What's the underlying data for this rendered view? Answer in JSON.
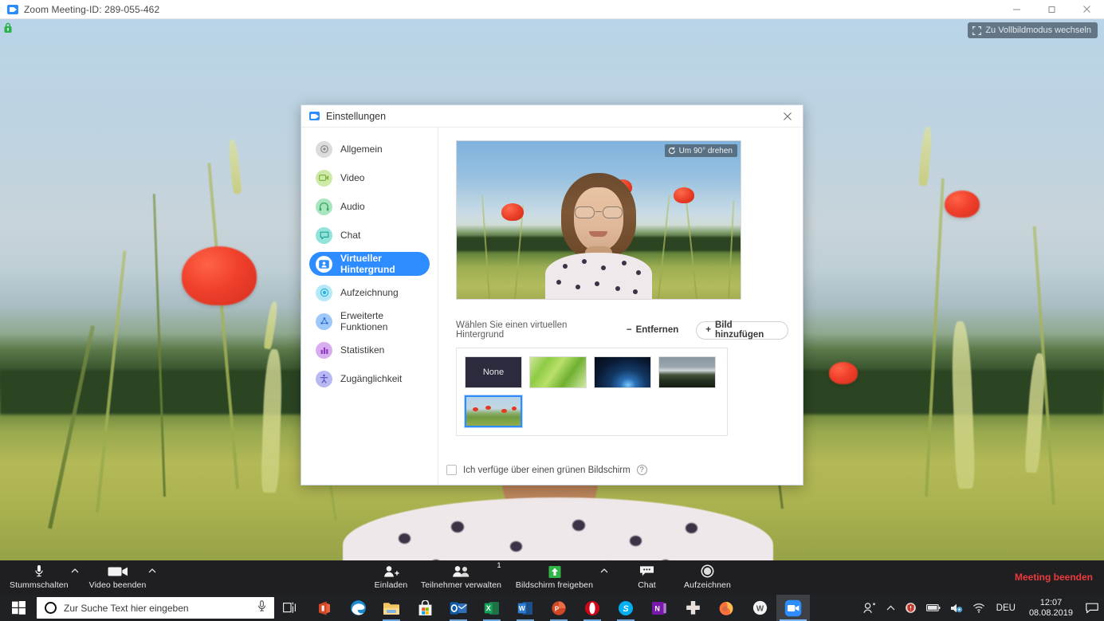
{
  "window": {
    "title": "Zoom Meeting-ID: 289-055-462",
    "minimize_label": "Minimieren",
    "maximize_label": "Maximieren",
    "close_label": "Schließen"
  },
  "stage": {
    "fullscreen_label": "Zu Vollbildmodus wechseln",
    "security_label": "Verschlüsselt"
  },
  "zoombar": {
    "mute_label": "Stummschalten",
    "mute_caret_label": "Audio-Optionen",
    "video_label": "Video beenden",
    "video_caret_label": "Video-Optionen",
    "invite_label": "Einladen",
    "participants_label": "Teilnehmer verwalten",
    "participants_count": "1",
    "share_label": "Bildschirm freigeben",
    "share_caret_label": "Freigabe-Optionen",
    "chat_label": "Chat",
    "record_label": "Aufzeichnen",
    "end_label": "Meeting beenden",
    "end_color": "#ec3b3b"
  },
  "dialog": {
    "title": "Einstellungen",
    "close_label": "Schließen",
    "accent_color": "#2d8cff",
    "sidebar": [
      {
        "label": "Allgemein",
        "icon": "gear-icon",
        "color": "#d8d8d8",
        "active": false
      },
      {
        "label": "Video",
        "icon": "video-camera-icon",
        "color": "#c8e6a0",
        "active": false
      },
      {
        "label": "Audio",
        "icon": "headphones-icon",
        "color": "#8fdca8",
        "active": false
      },
      {
        "label": "Chat",
        "icon": "chat-bubble-icon",
        "color": "#5ad2c4",
        "active": false
      },
      {
        "label": "Virtueller Hintergrund",
        "icon": "person-frame-icon",
        "color": "#2d8cff",
        "active": true
      },
      {
        "label": "Aufzeichnung",
        "icon": "record-circle-icon",
        "color": "#4cc8f0",
        "active": false
      },
      {
        "label": "Erweiterte Funktionen",
        "icon": "nodes-icon",
        "color": "#6aa8f5",
        "active": false
      },
      {
        "label": "Statistiken",
        "icon": "bar-chart-icon",
        "color": "#c07ae0",
        "active": false
      },
      {
        "label": "Zugänglichkeit",
        "icon": "accessibility-icon",
        "color": "#8f8fe8",
        "active": false
      }
    ],
    "preview": {
      "rotate_label": "Um 90° drehen"
    },
    "choose_label": "Wählen Sie einen virtuellen Hintergrund",
    "remove_label": "Entfernen",
    "remove_sign": "−",
    "add_label": "Bild hinzufügen",
    "add_sign": "+",
    "thumbnails": [
      {
        "name": "none",
        "label": "None",
        "kind": "none",
        "selected": false
      },
      {
        "name": "grass",
        "label": "",
        "kind": "grass",
        "selected": false
      },
      {
        "name": "earth-space",
        "label": "",
        "kind": "space",
        "selected": false
      },
      {
        "name": "mountains",
        "label": "",
        "kind": "mountain",
        "selected": false
      },
      {
        "name": "poppy-field",
        "label": "",
        "kind": "poppy",
        "selected": true
      }
    ],
    "greenscreen_label": "Ich verfüge über einen grünen Bildschirm",
    "greenscreen_checked": false,
    "help_glyph": "?"
  },
  "taskbar": {
    "start_label": "Start",
    "search_placeholder": "Zur Suche Text hier eingeben",
    "search_value": "",
    "cortana_label": "Cortana",
    "mic_label": "Spracheingabe",
    "taskview_label": "Taskansicht",
    "apps": [
      {
        "name": "office-icon",
        "label": "Office",
        "state": ""
      },
      {
        "name": "edge-icon",
        "label": "Microsoft Edge",
        "state": ""
      },
      {
        "name": "explorer-icon",
        "label": "Explorer",
        "state": "open"
      },
      {
        "name": "store-icon",
        "label": "Microsoft Store",
        "state": ""
      },
      {
        "name": "outlook-icon",
        "label": "Outlook",
        "state": "open"
      },
      {
        "name": "excel-icon",
        "label": "Excel",
        "state": "open"
      },
      {
        "name": "word-icon",
        "label": "Word",
        "state": "open"
      },
      {
        "name": "powerpoint-icon",
        "label": "PowerPoint",
        "state": "open"
      },
      {
        "name": "opera-icon",
        "label": "Opera",
        "state": "open"
      },
      {
        "name": "skype-icon",
        "label": "Skype",
        "state": "open"
      },
      {
        "name": "onenote-icon",
        "label": "OneNote",
        "state": ""
      },
      {
        "name": "medical-cross-icon",
        "label": "Praxisprogramm",
        "state": ""
      },
      {
        "name": "firefox-icon",
        "label": "Firefox",
        "state": ""
      },
      {
        "name": "w-circle-icon",
        "label": "W",
        "state": ""
      },
      {
        "name": "zoom-icon",
        "label": "Zoom",
        "state": "active"
      }
    ],
    "tray": {
      "people_label": "Personen",
      "overflow_label": "Ausgeblendete Symbole einblenden",
      "shield_label": "Sicherheit",
      "battery_label": "Akku",
      "volume_label": "Lautstärke",
      "network_label": "Netzwerk",
      "language": "DEU",
      "time": "12:07",
      "date": "08.08.2019",
      "action_center_label": "Info-Center"
    }
  }
}
